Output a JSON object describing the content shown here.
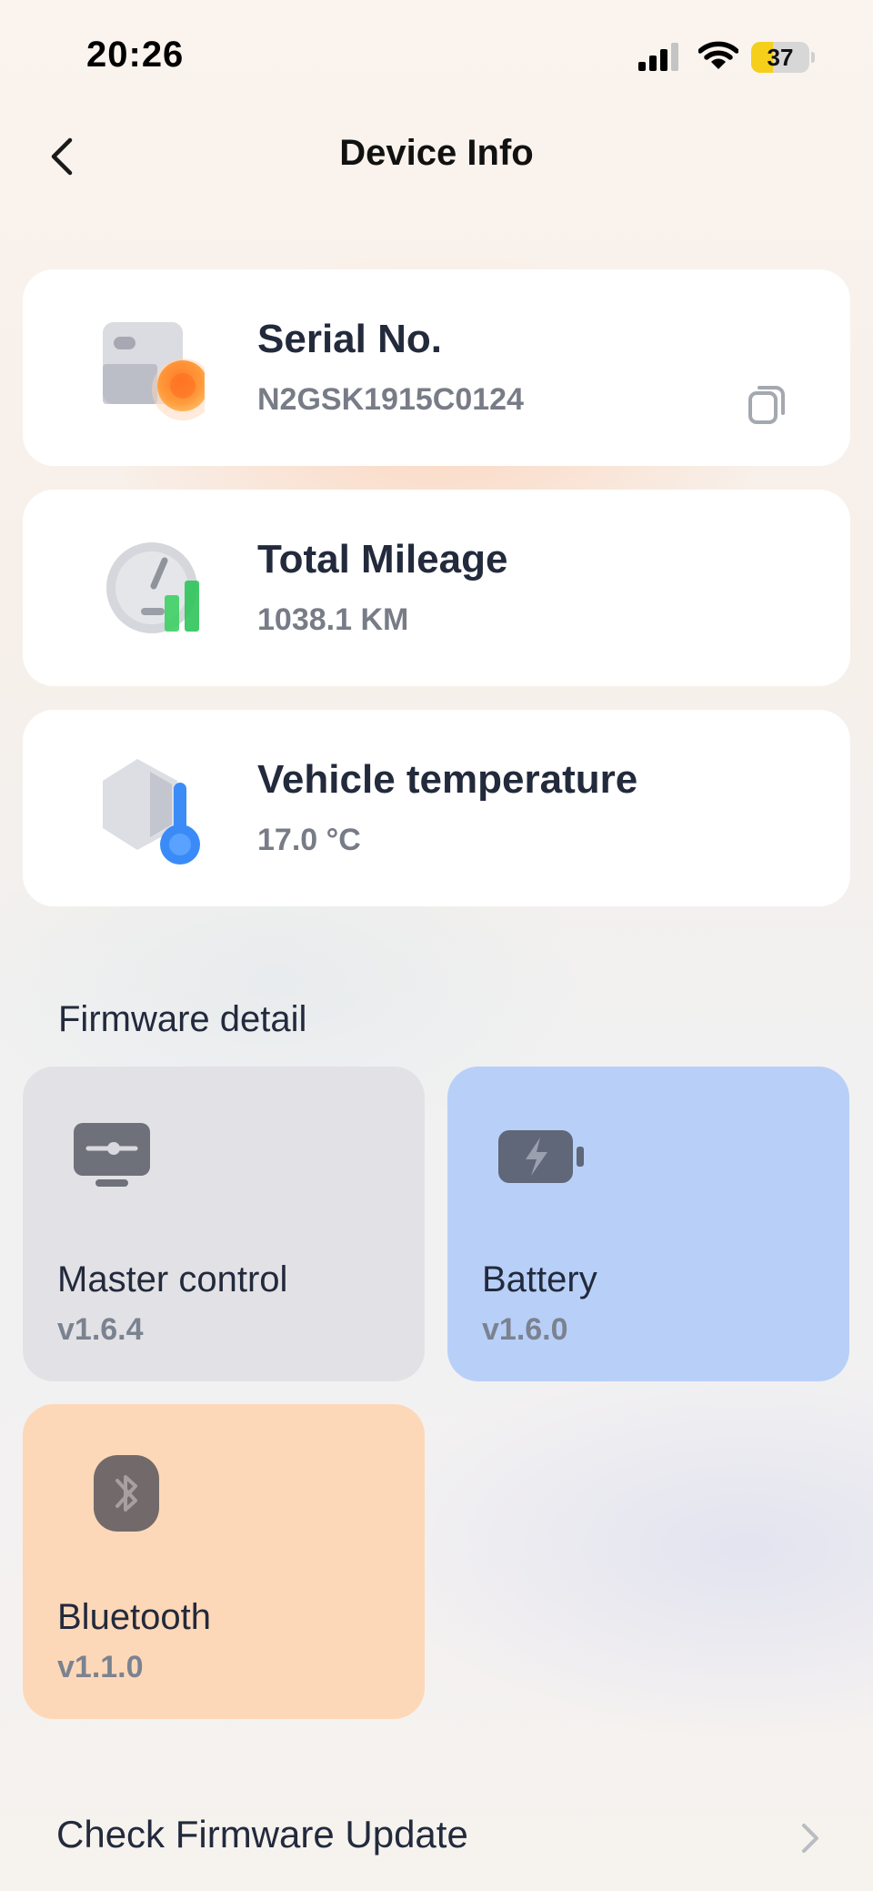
{
  "status_bar": {
    "time": "20:26",
    "battery_level": "37",
    "battery_fraction": 0.37,
    "icons": [
      "signal-icon",
      "wifi-icon",
      "battery-icon"
    ]
  },
  "nav": {
    "title": "Device Info",
    "back_icon": "chevron-left-icon"
  },
  "info_cards": [
    {
      "label": "Serial No.",
      "value": "N2GSK1915C0124",
      "icon": "serial-card-icon",
      "action_icon": "copy-icon"
    },
    {
      "label": "Total Mileage",
      "value": "1038.1 KM",
      "icon": "mileage-gauge-icon"
    },
    {
      "label": "Vehicle temperature",
      "value": "17.0 °C",
      "icon": "thermometer-icon"
    }
  ],
  "firmware": {
    "heading": "Firmware detail",
    "items": [
      {
        "name": "Master control",
        "version": "v1.6.4",
        "icon": "monitor-icon",
        "color": "#e2e2e6"
      },
      {
        "name": "Battery",
        "version": "v1.6.0",
        "icon": "battery-bolt-icon",
        "color": "#b8d0f8"
      },
      {
        "name": "Bluetooth",
        "version": "v1.1.0",
        "icon": "bluetooth-icon",
        "color": "#fdd8b8"
      }
    ]
  },
  "update": {
    "label": "Check Firmware Update",
    "icon": "chevron-right-icon"
  }
}
